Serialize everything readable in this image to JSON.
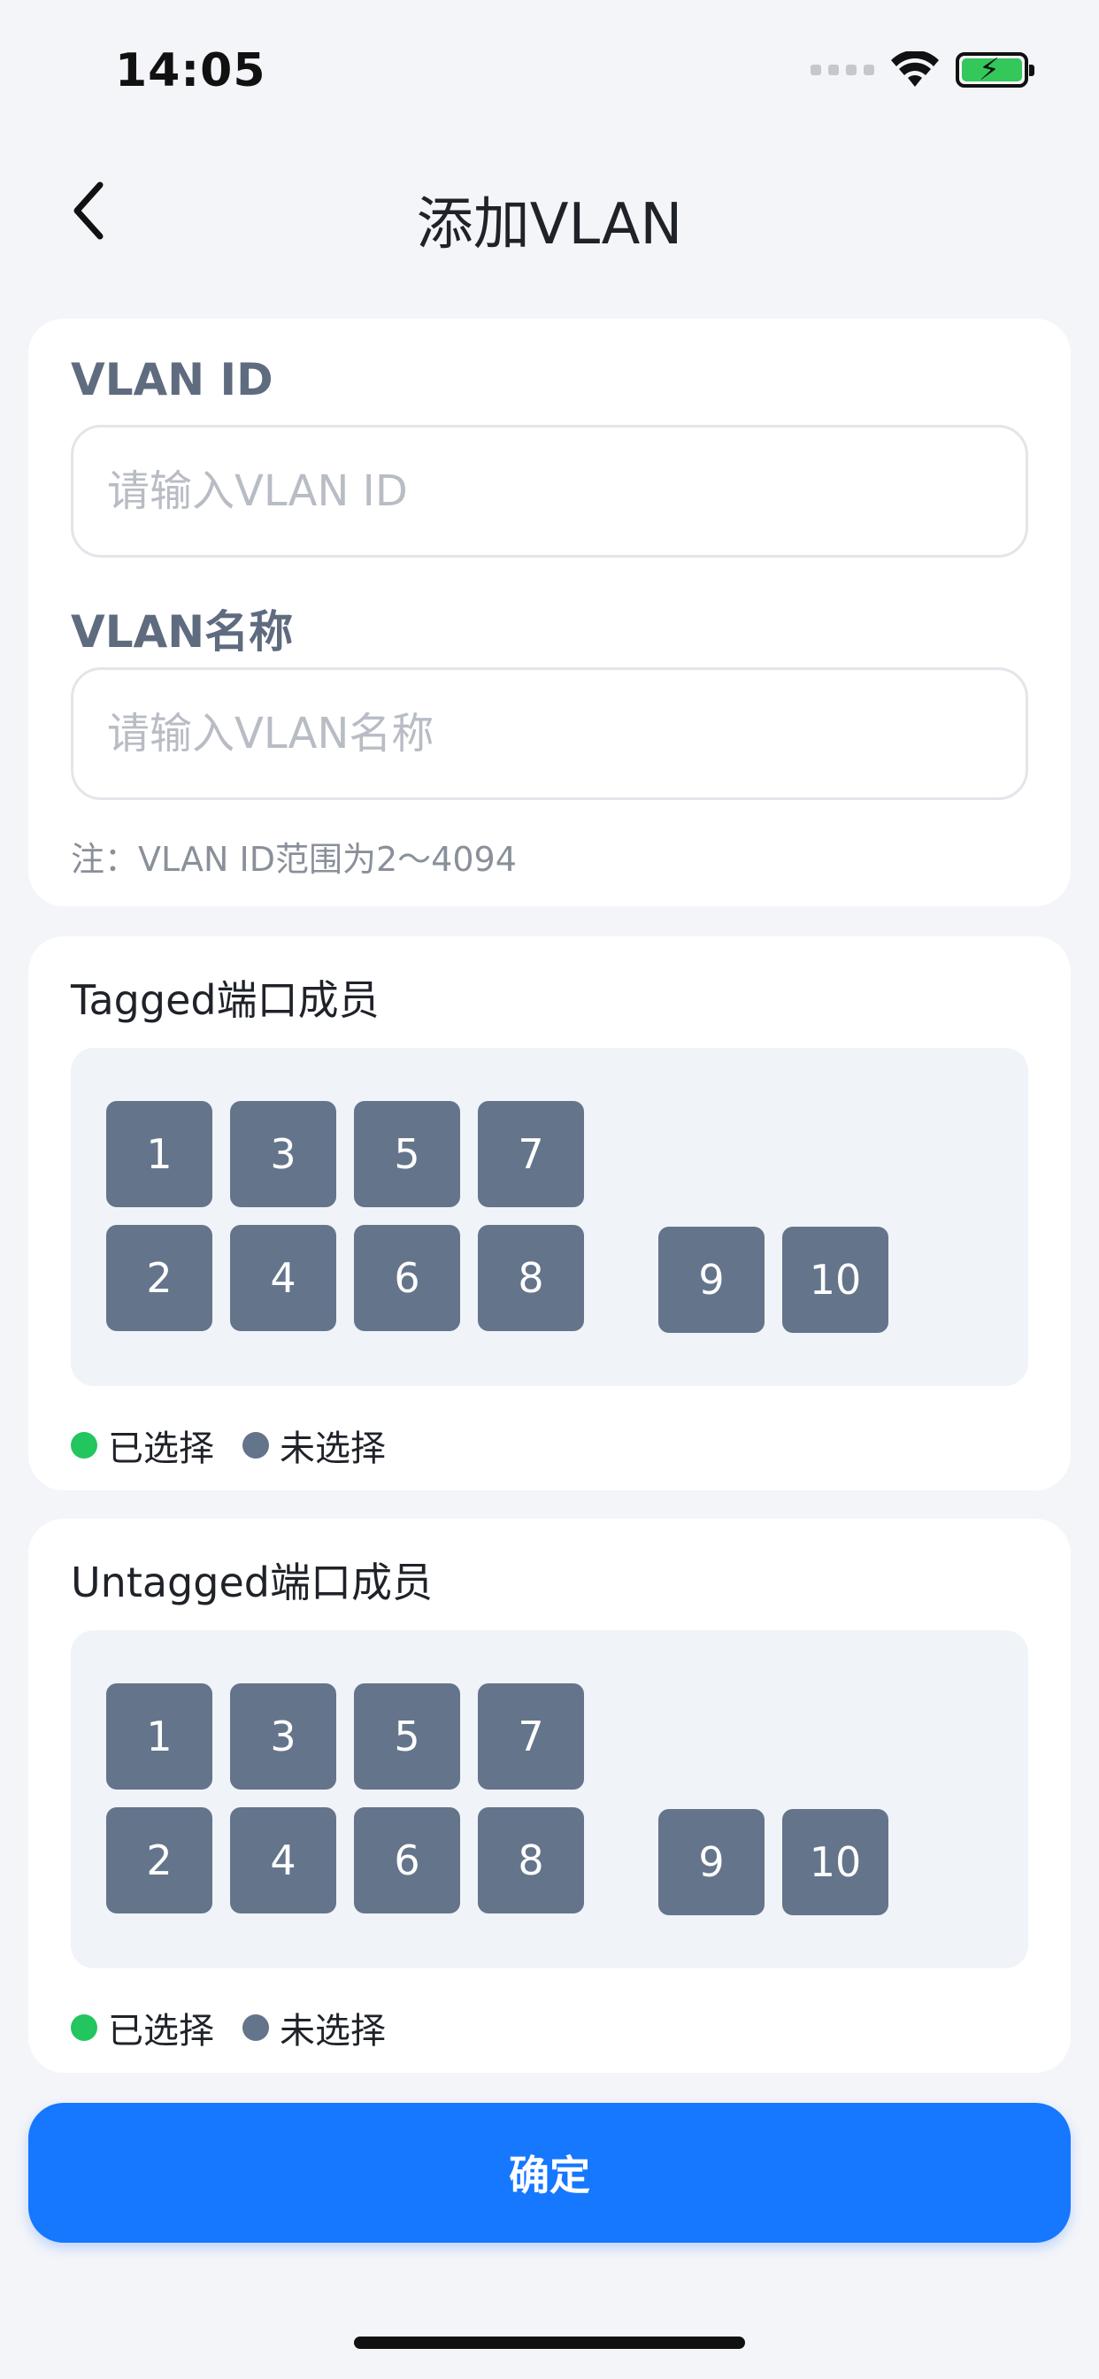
{
  "status_bar": {
    "time": "14:05"
  },
  "nav": {
    "title": "添加VLAN"
  },
  "form": {
    "vlan_id_label": "VLAN ID",
    "vlan_id_placeholder": "请输入VLAN ID",
    "vlan_id_value": "",
    "vlan_name_label": "VLAN名称",
    "vlan_name_placeholder": "请输入VLAN名称",
    "vlan_name_value": "",
    "note": "注：VLAN ID范围为2～4094"
  },
  "tagged": {
    "title": "Tagged端口成员",
    "ports": [
      "1",
      "2",
      "3",
      "4",
      "5",
      "6",
      "7",
      "8",
      "9",
      "10"
    ]
  },
  "untagged": {
    "title": "Untagged端口成员",
    "ports": [
      "1",
      "2",
      "3",
      "4",
      "5",
      "6",
      "7",
      "8",
      "9",
      "10"
    ]
  },
  "legend": {
    "selected": "已选择",
    "unselected": "未选择",
    "selected_color": "#22c55e",
    "unselected_color": "#64748b"
  },
  "confirm_label": "确定"
}
